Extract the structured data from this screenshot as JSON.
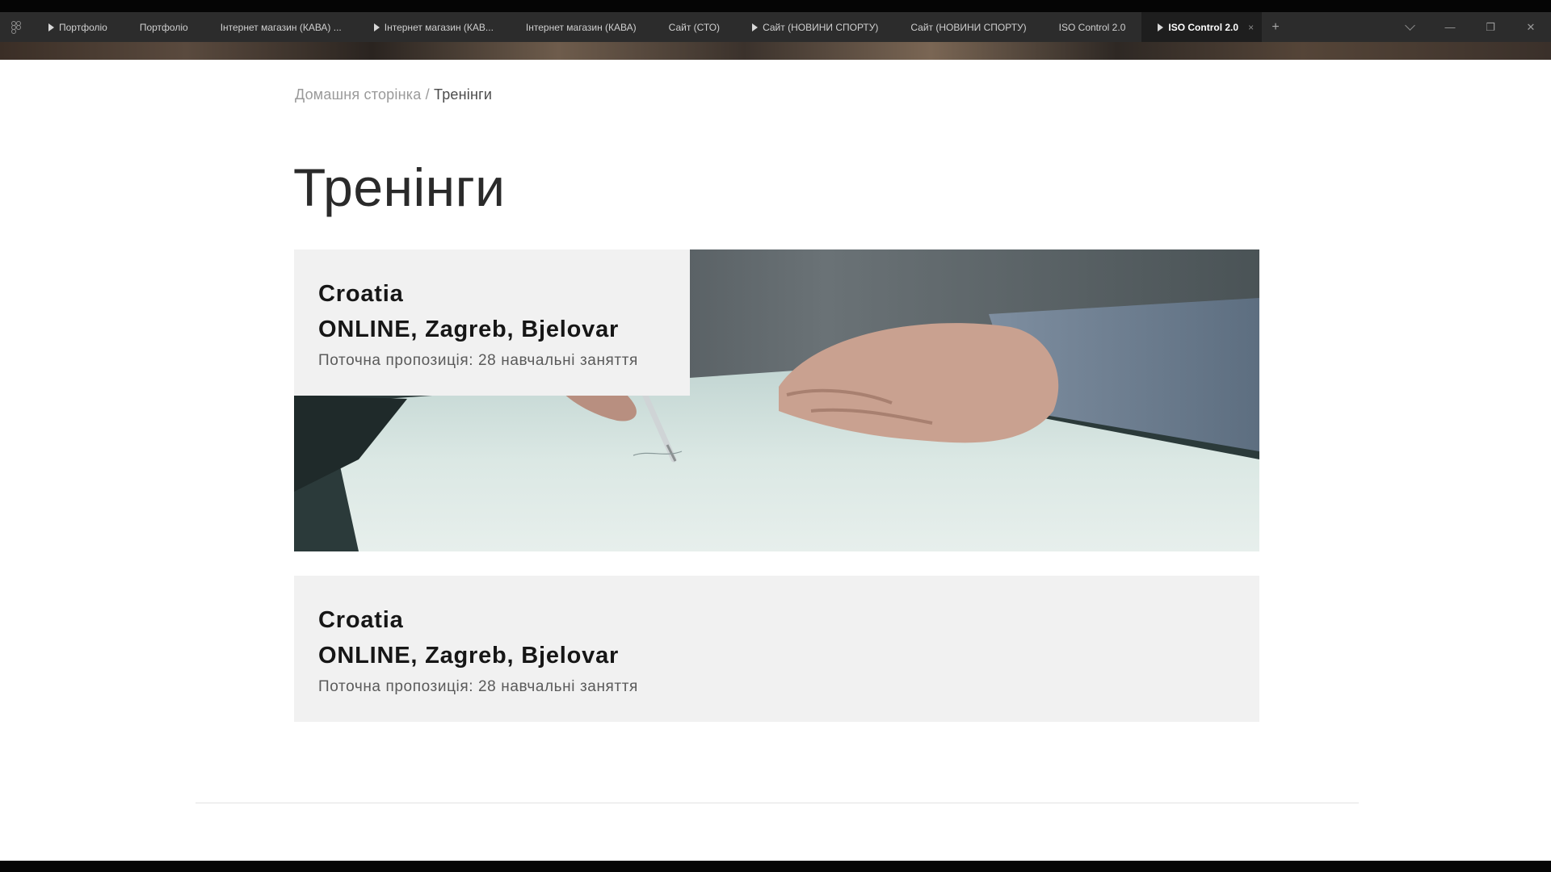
{
  "tabs": [
    {
      "label": "Портфоліо",
      "has_play": true,
      "active": false
    },
    {
      "label": "Портфоліо",
      "has_play": false,
      "active": false
    },
    {
      "label": "Інтернет магазин (КАВА) ...",
      "has_play": false,
      "active": false
    },
    {
      "label": "Інтернет магазин (КАВ...",
      "has_play": true,
      "active": false
    },
    {
      "label": "Інтернет магазин (КАВА)",
      "has_play": false,
      "active": false
    },
    {
      "label": "Сайт (СТО)",
      "has_play": false,
      "active": false
    },
    {
      "label": "Сайт (НОВИНИ СПОРТУ)",
      "has_play": true,
      "active": false
    },
    {
      "label": "Сайт (НОВИНИ СПОРТУ)",
      "has_play": false,
      "active": false
    },
    {
      "label": "ISO Control 2.0",
      "has_play": false,
      "active": false
    },
    {
      "label": "ISO Control 2.0",
      "has_play": true,
      "active": true
    }
  ],
  "tabbar": {
    "close_glyph": "×",
    "add_glyph": "+",
    "minimize_glyph": "—",
    "restore_glyph": "❐",
    "window_close_glyph": "✕",
    "app_icon": "figma-logo-icon"
  },
  "breadcrumb": {
    "home": "Домашня сторінка",
    "separator": " / ",
    "current": "Тренінги"
  },
  "page": {
    "title": "Тренінги"
  },
  "cards": [
    {
      "country": "Croatia",
      "cities": "ONLINE, Zagreb, Bjelovar",
      "offer": "Поточна пропозиція: 28 навчальні заняття",
      "image": "hands-signing-document-photo"
    },
    {
      "country": "Croatia",
      "cities": "ONLINE, Zagreb, Bjelovar",
      "offer": "Поточна пропозиція: 28 навчальні заняття"
    }
  ],
  "colors": {
    "tabbar_bg": "#2c2c2c",
    "active_tab_bg": "#1e1e1e",
    "card_bg": "#f1f1f1",
    "page_bg": "#ffffff",
    "title_text": "#2a2a2a"
  }
}
